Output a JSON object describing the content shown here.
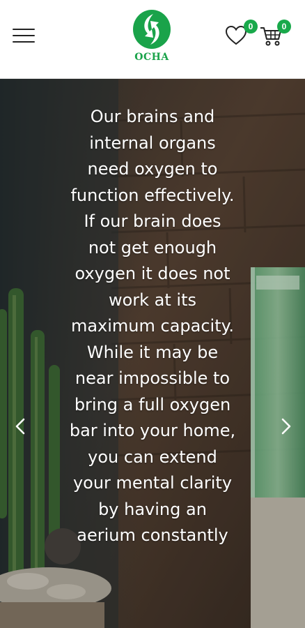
{
  "header": {
    "logo_text": "OCHA",
    "wishlist_count": "0",
    "cart_count": "0"
  },
  "hero": {
    "text": "Our brains and internal organs need oxygen to function effectively. If our brain does not get enough oxygen it does not work at its maximum capacity. While it may be near impossible to bring a full oxygen bar into your home, you can extend your mental clarity by having an aerium constantly"
  },
  "icons": {
    "menu": "hamburger-menu-icon",
    "wishlist": "heart-icon",
    "cart": "cart-icon",
    "prev": "chevron-left-icon",
    "next": "chevron-right-icon"
  },
  "colors": {
    "brand_green": "#1aa34a",
    "badge_green": "#19a94b"
  }
}
